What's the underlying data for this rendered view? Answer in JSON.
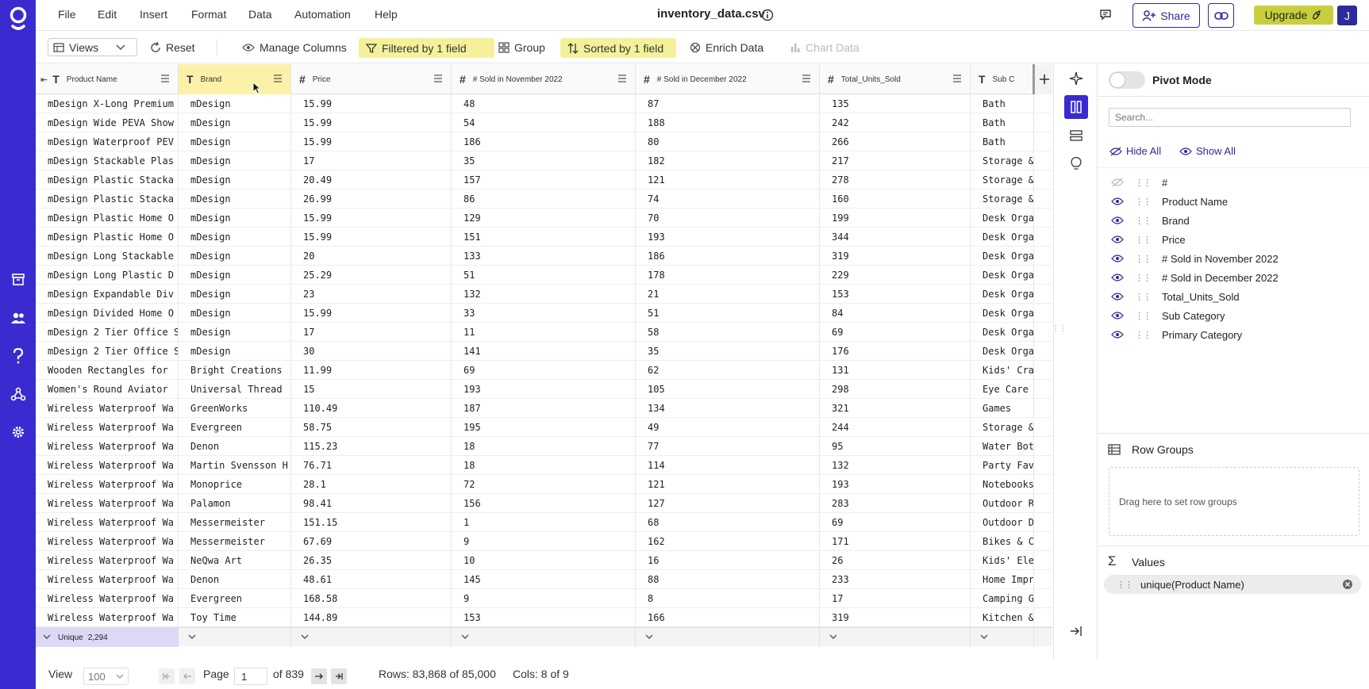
{
  "app": {
    "file_title": "inventory_data.csv",
    "menu": [
      "File",
      "Edit",
      "Insert",
      "Format",
      "Data",
      "Automation",
      "Help"
    ],
    "share_label": "Share",
    "upgrade_label": "Upgrade",
    "user_initial": "J",
    "accent_color": "#3a2bd0",
    "highlight_color": "#f4f19a"
  },
  "toolbar": {
    "views_label": "Views",
    "reset_label": "Reset",
    "manage_columns_label": "Manage Columns",
    "filter_label": "Filtered by 1 field",
    "group_label": "Group",
    "sort_label": "Sorted by 1 field",
    "enrich_label": "Enrich Data",
    "chart_label": "Chart Data"
  },
  "grid": {
    "columns": [
      "Product Name",
      "Brand",
      "Price",
      "# Sold in November 2022",
      "# Sold in December 2022",
      "Total_Units_Sold",
      "Sub C"
    ],
    "rows": [
      [
        "mDesign X-Long Premium",
        "mDesign",
        "15.99",
        "48",
        "87",
        "135",
        "Bath"
      ],
      [
        "mDesign Wide PEVA Show",
        "mDesign",
        "15.99",
        "54",
        "188",
        "242",
        "Bath"
      ],
      [
        "mDesign Waterproof PEV",
        "mDesign",
        "15.99",
        "186",
        "80",
        "266",
        "Bath"
      ],
      [
        "mDesign Stackable Plas",
        "mDesign",
        "17",
        "35",
        "182",
        "217",
        "Storage & Or"
      ],
      [
        "mDesign Plastic Stacka",
        "mDesign",
        "20.49",
        "157",
        "121",
        "278",
        "Storage & Or"
      ],
      [
        "mDesign Plastic Stacka",
        "mDesign",
        "26.99",
        "86",
        "74",
        "160",
        "Storage & Or"
      ],
      [
        "mDesign Plastic Home O",
        "mDesign",
        "15.99",
        "129",
        "70",
        "199",
        "Desk Organiz"
      ],
      [
        "mDesign Plastic Home O",
        "mDesign",
        "15.99",
        "151",
        "193",
        "344",
        "Desk Organiz"
      ],
      [
        "mDesign Long Stackable",
        "mDesign",
        "20",
        "133",
        "186",
        "319",
        "Desk Organiz"
      ],
      [
        "mDesign Long Plastic D",
        "mDesign",
        "25.29",
        "51",
        "178",
        "229",
        "Desk Organiz"
      ],
      [
        "mDesign Expandable Div",
        "mDesign",
        "23",
        "132",
        "21",
        "153",
        "Desk Organiz"
      ],
      [
        "mDesign Divided Home O",
        "mDesign",
        "15.99",
        "33",
        "51",
        "84",
        "Desk Organiz"
      ],
      [
        "mDesign 2 Tier Office Sp",
        "mDesign",
        "17",
        "11",
        "58",
        "69",
        "Desk Organiz"
      ],
      [
        "mDesign 2 Tier Office Sp",
        "mDesign",
        "30",
        "141",
        "35",
        "176",
        "Desk Organiz"
      ],
      [
        "Wooden Rectangles for",
        "Bright Creations",
        "11.99",
        "69",
        "62",
        "131",
        "Kids' Crafts"
      ],
      [
        "Women's Round Aviator",
        "Universal Thread",
        "15",
        "193",
        "105",
        "298",
        "Eye Care"
      ],
      [
        "Wireless Waterproof Wa",
        "GreenWorks",
        "110.49",
        "187",
        "134",
        "321",
        "Games"
      ],
      [
        "Wireless Waterproof Wa",
        "Evergreen",
        "58.75",
        "195",
        "49",
        "244",
        "Storage & Or"
      ],
      [
        "Wireless Waterproof Wa",
        "Denon",
        "115.23",
        "18",
        "77",
        "95",
        "Water Bottle"
      ],
      [
        "Wireless Waterproof Wa",
        "Martin Svensson H",
        "76.71",
        "18",
        "114",
        "132",
        "Party Favors"
      ],
      [
        "Wireless Waterproof Wa",
        "Monoprice",
        "28.1",
        "72",
        "121",
        "193",
        "Notebooks"
      ],
      [
        "Wireless Waterproof Wa",
        "Palamon",
        "98.41",
        "156",
        "127",
        "283",
        "Outdoor Recr"
      ],
      [
        "Wireless Waterproof Wa",
        "Messermeister",
        "151.15",
        "1",
        "68",
        "69",
        "Outdoor Deco"
      ],
      [
        "Wireless Waterproof Wa",
        "Messermeister",
        "67.69",
        "9",
        "162",
        "171",
        "Bikes & Cycl"
      ],
      [
        "Wireless Waterproof Wa",
        "NeQwa Art",
        "26.35",
        "10",
        "16",
        "26",
        "Kids' Electr"
      ],
      [
        "Wireless Waterproof Wa",
        "Denon",
        "48.61",
        "145",
        "88",
        "233",
        "Home Improve"
      ],
      [
        "Wireless Waterproof Wa",
        "Evergreen",
        "168.58",
        "9",
        "8",
        "17",
        "Camping Gear"
      ],
      [
        "Wireless Waterproof Wa",
        "Toy Time",
        "144.89",
        "153",
        "166",
        "319",
        "Kitchen & Di"
      ]
    ],
    "footer_label": "Unique",
    "footer_value": "2,294"
  },
  "status": {
    "view_label": "View",
    "page_size": "100",
    "page_label": "Page",
    "page_value": "1",
    "page_total": "of 839",
    "rows_text": "Rows: 83,868 of 85,000",
    "cols_text": "Cols: 8 of 9"
  },
  "panel": {
    "pivot_label": "Pivot Mode",
    "search_placeholder": "Search...",
    "hide_all": "Hide All",
    "show_all": "Show All",
    "columns": [
      "#",
      "Product Name",
      "Brand",
      "Price",
      "# Sold in November 2022",
      "# Sold in December 2022",
      "Total_Units_Sold",
      "Sub Category",
      "Primary Category"
    ],
    "row_groups_label": "Row Groups",
    "row_groups_hint": "Drag here to set row groups",
    "values_label": "Values",
    "value_item": "unique(Product Name)"
  }
}
